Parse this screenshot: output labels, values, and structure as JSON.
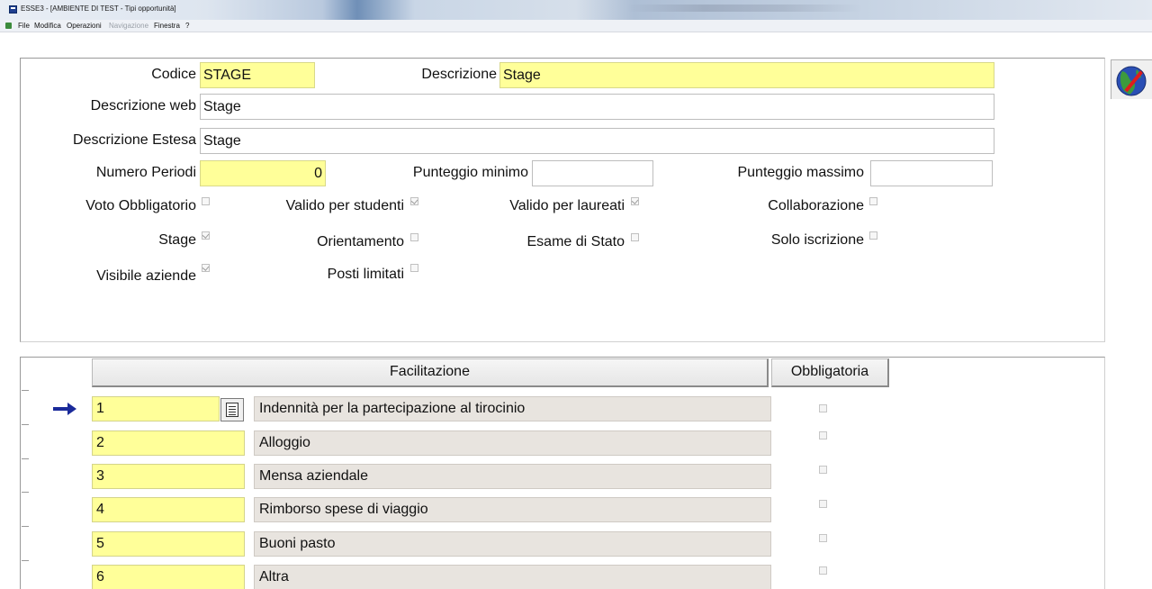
{
  "window": {
    "title": "ESSE3 - [AMBIENTE DI TEST - Tipi opportunità]"
  },
  "menu": [
    {
      "label": "File",
      "disabled": false
    },
    {
      "label": "Modifica",
      "disabled": false
    },
    {
      "label": "Operazioni",
      "disabled": false
    },
    {
      "label": "Navigazione",
      "disabled": true
    },
    {
      "label": "Finestra",
      "disabled": false
    },
    {
      "label": "?",
      "disabled": false
    }
  ],
  "form": {
    "codice_label": "Codice",
    "codice_value": "STAGE",
    "descrizione_label": "Descrizione",
    "descrizione_value": "Stage",
    "descrizione_web_label": "Descrizione web",
    "descrizione_web_value": "Stage",
    "descrizione_estesa_label": "Descrizione Estesa",
    "descrizione_estesa_value": "Stage",
    "numero_periodi_label": "Numero Periodi",
    "numero_periodi_value": "0",
    "punteggio_minimo_label": "Punteggio minimo",
    "punteggio_minimo_value": "",
    "punteggio_massimo_label": "Punteggio massimo",
    "punteggio_massimo_value": "",
    "checkboxes": {
      "voto_obbligatorio": {
        "label": "Voto Obbligatorio",
        "checked": false
      },
      "valido_studenti": {
        "label": "Valido per studenti",
        "checked": true
      },
      "valido_laureati": {
        "label": "Valido per laureati",
        "checked": true
      },
      "collaborazione": {
        "label": "Collaborazione",
        "checked": false
      },
      "stage": {
        "label": "Stage",
        "checked": true
      },
      "orientamento": {
        "label": "Orientamento",
        "checked": false
      },
      "esame_di_stato": {
        "label": "Esame di Stato",
        "checked": false
      },
      "solo_iscrizione": {
        "label": "Solo iscrizione",
        "checked": false
      },
      "visibile_aziende": {
        "label": "Visibile aziende",
        "checked": true
      },
      "posti_limitati": {
        "label": "Posti limitati",
        "checked": false
      }
    }
  },
  "grid": {
    "header_facilitazione": "Facilitazione",
    "header_obbligatoria": "Obbligatoria",
    "rows": [
      {
        "code": "1",
        "desc": "Indennità per la partecipazione al tirocinio",
        "obbligatoria": false
      },
      {
        "code": "2",
        "desc": "Alloggio",
        "obbligatoria": false
      },
      {
        "code": "3",
        "desc": "Mensa aziendale",
        "obbligatoria": false
      },
      {
        "code": "4",
        "desc": "Rimborso spese di viaggio",
        "obbligatoria": false
      },
      {
        "code": "5",
        "desc": "Buoni pasto",
        "obbligatoria": false
      },
      {
        "code": "6",
        "desc": "Altra",
        "obbligatoria": false
      }
    ]
  },
  "icons": {
    "app": "app-icon",
    "globe": "globe-help-icon",
    "lookup": "lookup-document-icon",
    "current_row": "current-row-arrow-icon"
  },
  "colors": {
    "required_field": "#ffff99",
    "readonly_cell": "#e8e4df",
    "arrow": "#1a2a9a"
  }
}
